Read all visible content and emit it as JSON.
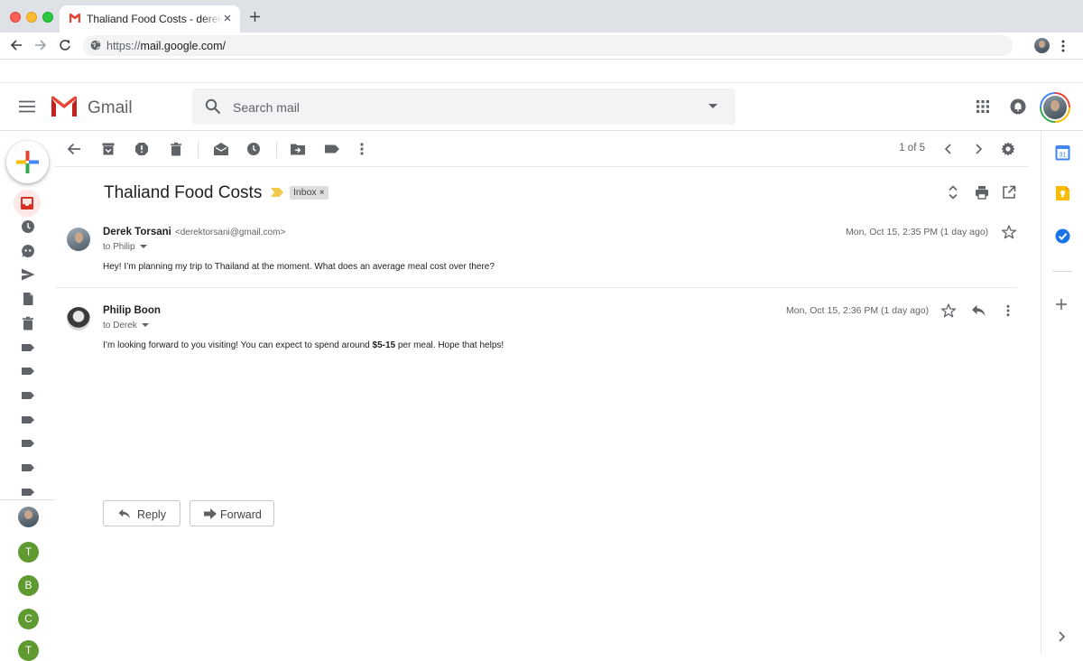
{
  "browser": {
    "tab_title": "Thaliand Food Costs - derektorsani@gmail.com",
    "url_scheme": "https://",
    "url_host": "mail.google.com/"
  },
  "gmail": {
    "app_name": "Gmail",
    "search_placeholder": "Search mail"
  },
  "left_rail": {
    "contacts": [
      "T",
      "B",
      "C",
      "T"
    ]
  },
  "toolbar": {
    "pager": "1 of 5"
  },
  "thread": {
    "subject": "Thaliand Food Costs",
    "label": "Inbox",
    "label_remove": "×",
    "messages": [
      {
        "sender": "Derek Torsani",
        "email": "<derektorsani@gmail.com>",
        "to": "to Philip",
        "date": "Mon, Oct 15, 2:35 PM (1 day ago)",
        "body": "Hey! I’m planning my trip to Thailand at the moment. What does an average meal cost over there?"
      },
      {
        "sender": "Philip Boon",
        "to": "to Derek",
        "date": "Mon, Oct 15, 2:36 PM (1 day ago)",
        "body_before": "I’m looking forward to you visiting! You can expect to spend around ",
        "body_highlight": "$5-15",
        "body_after": " per meal. Hope that helps!"
      }
    ],
    "reply_label": "Reply",
    "forward_label": "Forward"
  },
  "colors": {
    "gmail_red": "#ea4335",
    "contact_green": "#5e9a30",
    "importance_yellow": "#f2c94c",
    "calendar_blue": "#4285f4",
    "keep_yellow": "#fbbc04",
    "tasks_blue": "#1a73e8"
  }
}
